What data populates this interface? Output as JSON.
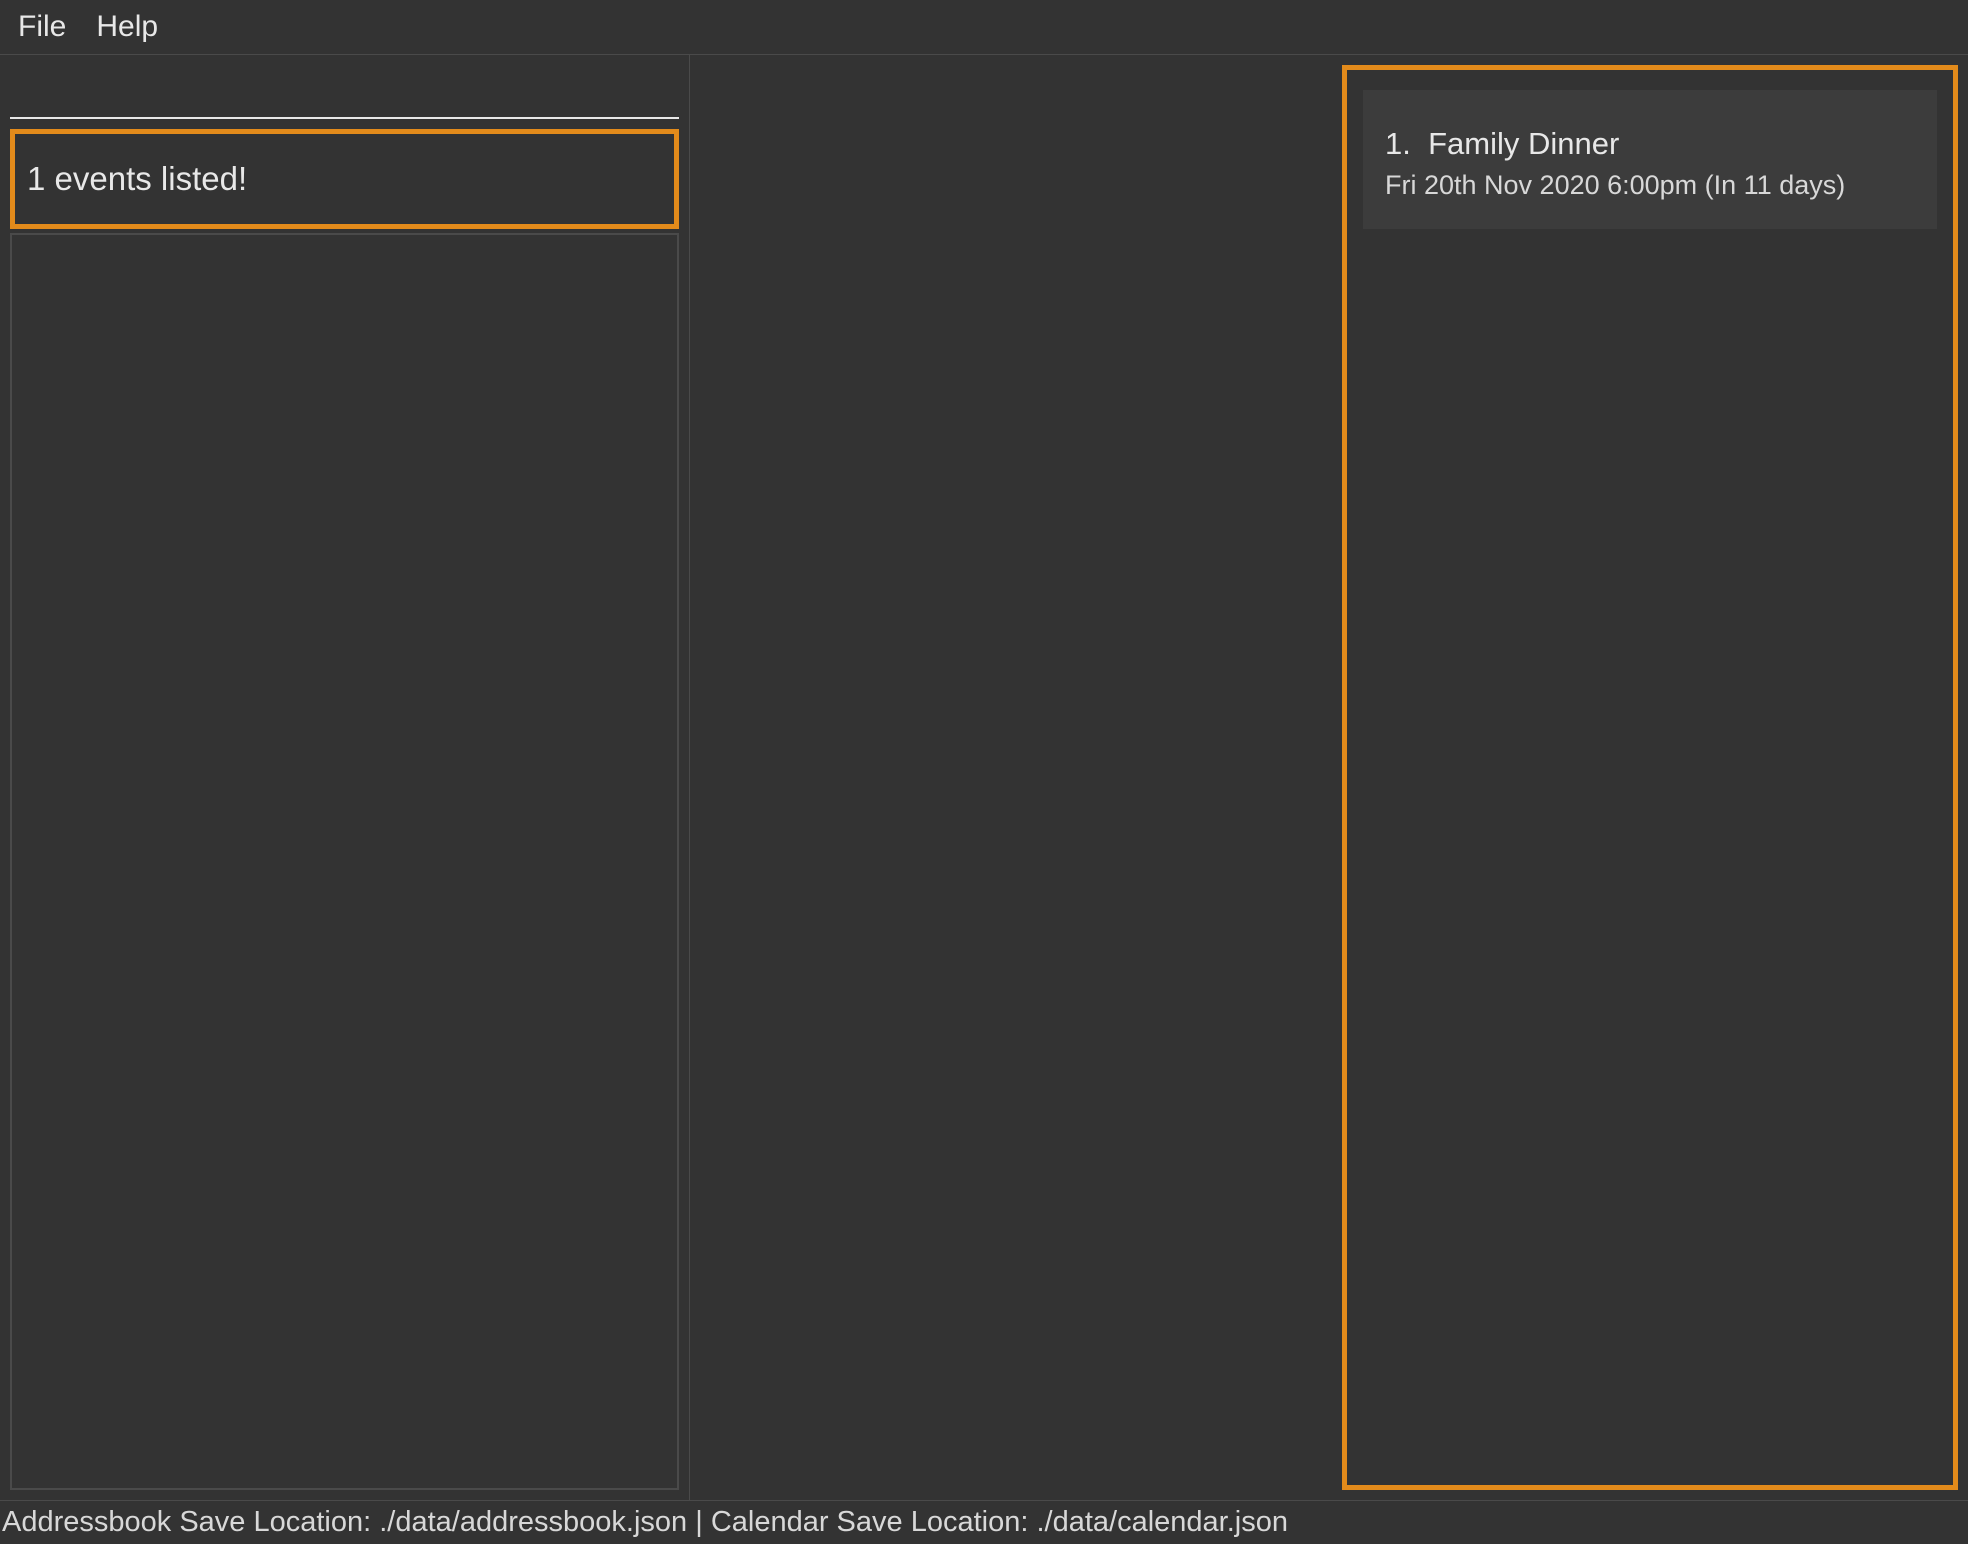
{
  "menubar": {
    "file": "File",
    "help": "Help"
  },
  "command": {
    "value": "",
    "placeholder": ""
  },
  "message": "1 events listed!",
  "events": [
    {
      "index": "1.",
      "title": "Family Dinner",
      "time": "Fri 20th Nov 2020 6:00pm (In 11 days)"
    }
  ],
  "statusbar": "Addressbook Save Location: ./data/addressbook.json | Calendar Save Location: ./data/calendar.json",
  "colors": {
    "highlight": "#e38b1b",
    "background": "#333333",
    "text": "#e8e8e8"
  }
}
